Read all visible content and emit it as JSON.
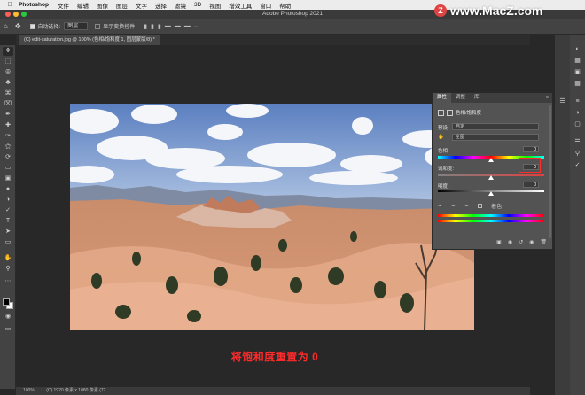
{
  "menubar": {
    "app_name": "Photoshop",
    "items": [
      "文件",
      "编辑",
      "图像",
      "图层",
      "文字",
      "选择",
      "滤镜",
      "3D",
      "视图",
      "增效工具",
      "窗口",
      "帮助"
    ]
  },
  "window": {
    "title": "Adobe Photoshop 2021"
  },
  "options_bar": {
    "auto_select_label": "自动选择:",
    "auto_select_value": "图层",
    "show_transform_label": "显示变换控件"
  },
  "document_tab": {
    "label": "(C) edit-saturation.jpg @ 100% (色相/饱和度 1, 图层蒙版/8) *"
  },
  "properties_panel": {
    "tabs": [
      "属性",
      "调整",
      "库"
    ],
    "header": "色相/饱和度",
    "preset_label": "预设:",
    "preset_value": "自定",
    "channel_value": "全图",
    "hue_label": "色相:",
    "hue_value": "0",
    "saturation_label": "饱和度:",
    "saturation_value": "0",
    "lightness_label": "明度:",
    "lightness_value": "0",
    "colorize_label": "着色"
  },
  "caption": "将饱和度重置为 0",
  "status_bar": {
    "zoom": "100%",
    "info": "(C) 1920 像素 x 1080 像素 (72..."
  },
  "watermark": {
    "text": "www.MacZ.com",
    "badge": "Z"
  },
  "colors": {
    "highlight": "#ff2d2d",
    "caption": "#ff2a2a"
  }
}
